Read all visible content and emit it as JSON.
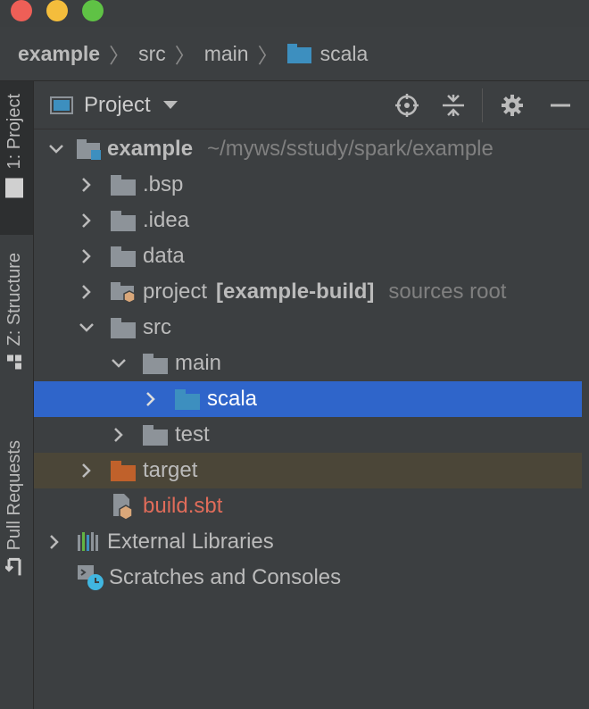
{
  "breadcrumb": {
    "items": [
      "example",
      "src",
      "main",
      "scala"
    ]
  },
  "toolwindow_tabs": {
    "project": "1: Project",
    "structure": "Z: Structure",
    "pull_requests": "Pull Requests"
  },
  "panel": {
    "title": "Project"
  },
  "tree": {
    "root": {
      "name": "example",
      "path": "~/myws/sstudy/spark/example"
    },
    "bsp": ".bsp",
    "idea": ".idea",
    "data": "data",
    "project": {
      "name": "project",
      "module": "[example-build]",
      "note": "sources root"
    },
    "src": "src",
    "main": "main",
    "scala": "scala",
    "test": "test",
    "target": "target",
    "build_sbt": "build.sbt",
    "external_libraries": "External Libraries",
    "scratches": "Scratches and Consoles"
  },
  "colors": {
    "selection": "#2f65ca",
    "source_folder": "#3d8fbf",
    "excluded_folder": "#c0612b",
    "modified_file": "#e06c5a"
  },
  "icons": [
    "crosshair-icon",
    "collapse-all-icon",
    "gear-icon",
    "minimize-icon"
  ]
}
